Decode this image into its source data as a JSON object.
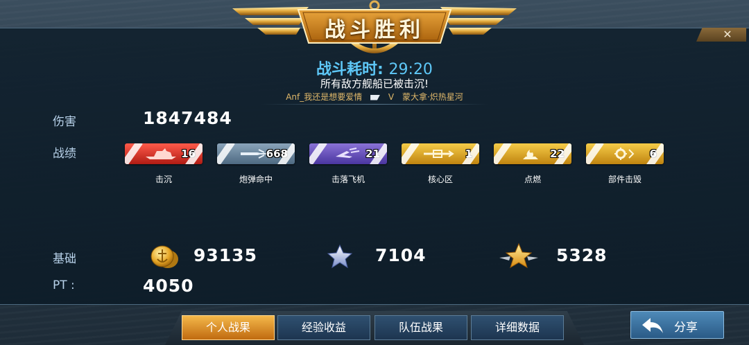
{
  "banner": {
    "title": "战斗胜利",
    "close_symbol": "✕"
  },
  "summary": {
    "duration_label": "战斗耗时:",
    "duration_value": "29:20",
    "result_message": "所有敌方舰船已被击沉!",
    "player_left": "Anf_我还是想要爱情",
    "vs": "V",
    "player_right": "蒙大拿·炽热星河"
  },
  "damage": {
    "label": "伤害",
    "value": "1847484"
  },
  "record": {
    "label": "战绩",
    "medals": [
      {
        "label": "击沉",
        "count": "16",
        "color": "#d8322a",
        "icon": "ship-icon"
      },
      {
        "label": "炮弹命中",
        "count": "668",
        "color": "#6a86a0",
        "icon": "shell-icon"
      },
      {
        "label": "击落飞机",
        "count": "21",
        "color": "#6a52be",
        "icon": "plane-icon"
      },
      {
        "label": "核心区",
        "count": "1",
        "color": "#e0a828",
        "icon": "core-icon"
      },
      {
        "label": "点燃",
        "count": "22",
        "color": "#e0a828",
        "icon": "fire-icon"
      },
      {
        "label": "部件击毁",
        "count": "6",
        "color": "#e0a828",
        "icon": "gear-icon"
      }
    ]
  },
  "base": {
    "label": "基础",
    "coins": "93135",
    "star_silver": "7104",
    "star_gold": "5328"
  },
  "pt": {
    "label": "PT :",
    "value": "4050"
  },
  "tabs": [
    {
      "label": "个人战果",
      "active": true
    },
    {
      "label": "经验收益",
      "active": false
    },
    {
      "label": "队伍战果",
      "active": false
    },
    {
      "label": "详细数据",
      "active": false
    }
  ],
  "share": {
    "label": "分享"
  }
}
